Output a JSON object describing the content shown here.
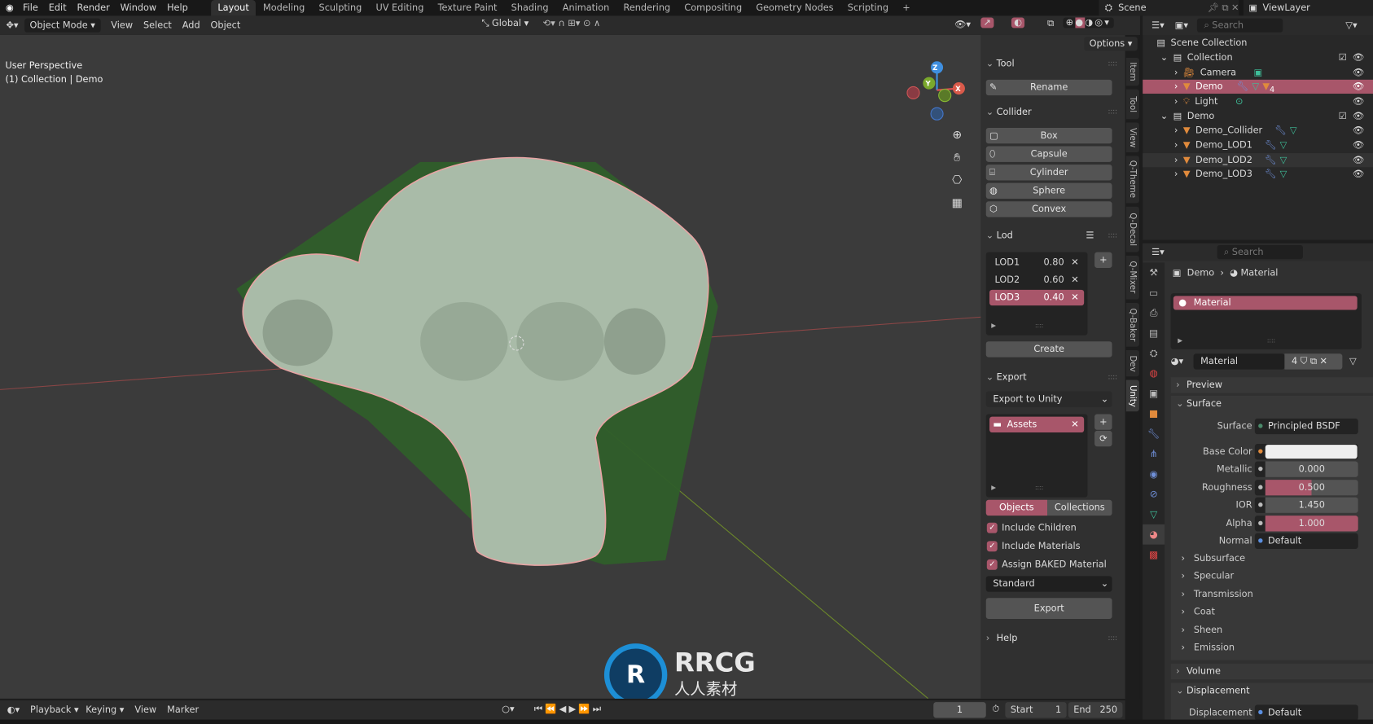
{
  "topbar": {
    "menus": [
      "File",
      "Edit",
      "Render",
      "Window",
      "Help"
    ],
    "workspaces": [
      "Layout",
      "Modeling",
      "Sculpting",
      "UV Editing",
      "Texture Paint",
      "Shading",
      "Animation",
      "Rendering",
      "Compositing",
      "Geometry Nodes",
      "Scripting"
    ],
    "active_workspace": "Layout",
    "scene": "Scene",
    "view_layer": "ViewLayer"
  },
  "viewport_header": {
    "mode": "Object Mode",
    "menus": [
      "View",
      "Select",
      "Add",
      "Object"
    ],
    "orientation": "Global",
    "options": "Options"
  },
  "viewport": {
    "perspective": "User Perspective",
    "context": "(1) Collection | Demo",
    "gizmo": {
      "x": "X",
      "y": "Y",
      "z": "Z"
    }
  },
  "npanel": {
    "tool": {
      "title": "Tool",
      "rename": "Rename"
    },
    "collider": {
      "title": "Collider",
      "buttons": [
        "Box",
        "Capsule",
        "Cylinder",
        "Sphere",
        "Convex"
      ]
    },
    "lod": {
      "title": "Lod",
      "items": [
        {
          "name": "LOD1",
          "value": "0.80"
        },
        {
          "name": "LOD2",
          "value": "0.60"
        },
        {
          "name": "LOD3",
          "value": "0.40"
        }
      ],
      "selected": "LOD3",
      "create": "Create"
    },
    "export": {
      "title": "Export",
      "target": "Export to Unity",
      "folders": [
        "Assets"
      ],
      "mode_tabs": [
        "Objects",
        "Collections"
      ],
      "active_mode": "Objects",
      "checkboxes": [
        {
          "label": "Include Children",
          "checked": true
        },
        {
          "label": "Include Materials",
          "checked": true
        },
        {
          "label": "Assign BAKED Material",
          "checked": true
        }
      ],
      "shader": "Standard",
      "export": "Export"
    },
    "help": {
      "title": "Help"
    },
    "tabs": [
      "Item",
      "Tool",
      "View",
      "Q-Theme",
      "Q-Decal",
      "Q-Mixer",
      "Q-Baker",
      "Dev",
      "Unity"
    ],
    "active_tab": "Unity"
  },
  "outliner": {
    "search_placeholder": "Search",
    "rows": [
      {
        "name": "Scene Collection"
      },
      {
        "name": "Collection"
      },
      {
        "name": "Camera"
      },
      {
        "name": "Demo",
        "selected": true,
        "badge": "4"
      },
      {
        "name": "Light"
      },
      {
        "name": "Demo"
      },
      {
        "name": "Demo_Collider"
      },
      {
        "name": "Demo_LOD1"
      },
      {
        "name": "Demo_LOD2"
      },
      {
        "name": "Demo_LOD3"
      }
    ]
  },
  "properties": {
    "search_placeholder": "Search",
    "breadcrumb": [
      "Demo",
      "Material"
    ],
    "slots": [
      "Material"
    ],
    "material_name": "Material",
    "users": "4",
    "sections": {
      "preview": "Preview",
      "surface": "Surface",
      "volume": "Volume",
      "displacement": "Displacement"
    },
    "surface_rows": [
      {
        "label": "Surface",
        "value": "Principled BSDF"
      },
      {
        "label": "Base Color",
        "value": ""
      },
      {
        "label": "Metallic",
        "value": "0.000"
      },
      {
        "label": "Roughness",
        "value": "0.500",
        "fill": 0.5
      },
      {
        "label": "IOR",
        "value": "1.450"
      },
      {
        "label": "Alpha",
        "value": "1.000",
        "fill": 1.0
      },
      {
        "label": "Normal",
        "value": "Default"
      }
    ],
    "subpanels": [
      "Subsurface",
      "Specular",
      "Transmission",
      "Coat",
      "Sheen",
      "Emission"
    ],
    "displacement_row": {
      "label": "Displacement",
      "value": "Default"
    }
  },
  "timeline": {
    "menus": [
      "Playback",
      "Keying",
      "View",
      "Marker"
    ],
    "current_frame": "1",
    "start_label": "Start",
    "start": "1",
    "end_label": "End",
    "end": "250"
  },
  "watermark": {
    "text": "RRCG",
    "subtext": "人人素材"
  },
  "colors": {
    "accent": "#a8566a",
    "object": "#e08a3c",
    "mesh_data": "#3fbf9a",
    "modifier": "#6f8fd8"
  }
}
